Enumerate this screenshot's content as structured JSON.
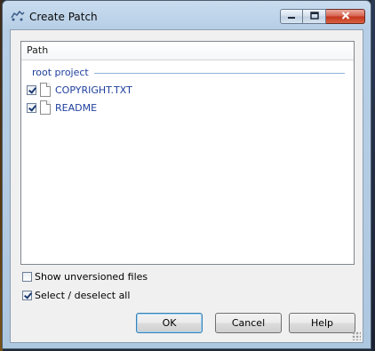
{
  "window": {
    "title": "Create Patch"
  },
  "list": {
    "column_header": "Path",
    "group_label": "root project",
    "files": [
      {
        "name": "COPYRIGHT.TXT",
        "checked": true
      },
      {
        "name": "README",
        "checked": true
      }
    ]
  },
  "options": {
    "show_unversioned": {
      "label": "Show unversioned files",
      "checked": false
    },
    "select_all": {
      "label": "Select / deselect all",
      "checked": true
    }
  },
  "buttons": {
    "ok": "OK",
    "cancel": "Cancel",
    "help": "Help"
  },
  "colors": {
    "link_blue": "#1f3f9d",
    "titlebar": "#b7cfe6",
    "close_red": "#c2341c"
  }
}
